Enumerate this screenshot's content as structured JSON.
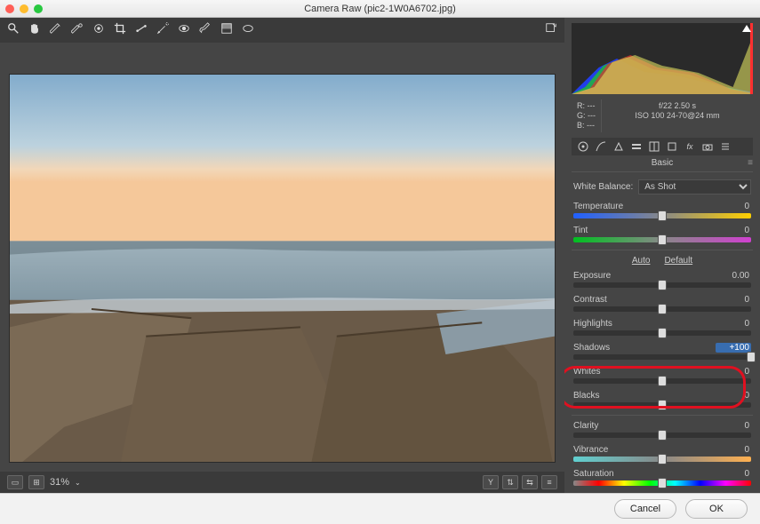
{
  "title": "Camera Raw (pic2-1W0A6702.jpg)",
  "zoom": "31%",
  "bottom_toolbar": {
    "label_y": "Y"
  },
  "metadata": {
    "R": "R:   ---",
    "G": "G:   ---",
    "B": "B:   ---",
    "exif_line1": "f/22    2.50 s",
    "exif_line2": "ISO 100   24-70@24 mm"
  },
  "panel_title": "Basic",
  "wb": {
    "label": "White Balance:",
    "value": "As Shot"
  },
  "sliders": {
    "temperature": {
      "label": "Temperature",
      "value": "0",
      "pos": 50
    },
    "tint": {
      "label": "Tint",
      "value": "0",
      "pos": 50
    },
    "exposure": {
      "label": "Exposure",
      "value": "0.00",
      "pos": 50
    },
    "contrast": {
      "label": "Contrast",
      "value": "0",
      "pos": 50
    },
    "highlights": {
      "label": "Highlights",
      "value": "0",
      "pos": 50
    },
    "shadows": {
      "label": "Shadows",
      "value": "+100",
      "pos": 100
    },
    "whites": {
      "label": "Whites",
      "value": "0",
      "pos": 50
    },
    "blacks": {
      "label": "Blacks",
      "value": "0",
      "pos": 50
    },
    "clarity": {
      "label": "Clarity",
      "value": "0",
      "pos": 50
    },
    "vibrance": {
      "label": "Vibrance",
      "value": "0",
      "pos": 50
    },
    "saturation": {
      "label": "Saturation",
      "value": "0",
      "pos": 50
    }
  },
  "auto_default": {
    "auto": "Auto",
    "default": "Default"
  },
  "buttons": {
    "cancel": "Cancel",
    "ok": "OK"
  }
}
